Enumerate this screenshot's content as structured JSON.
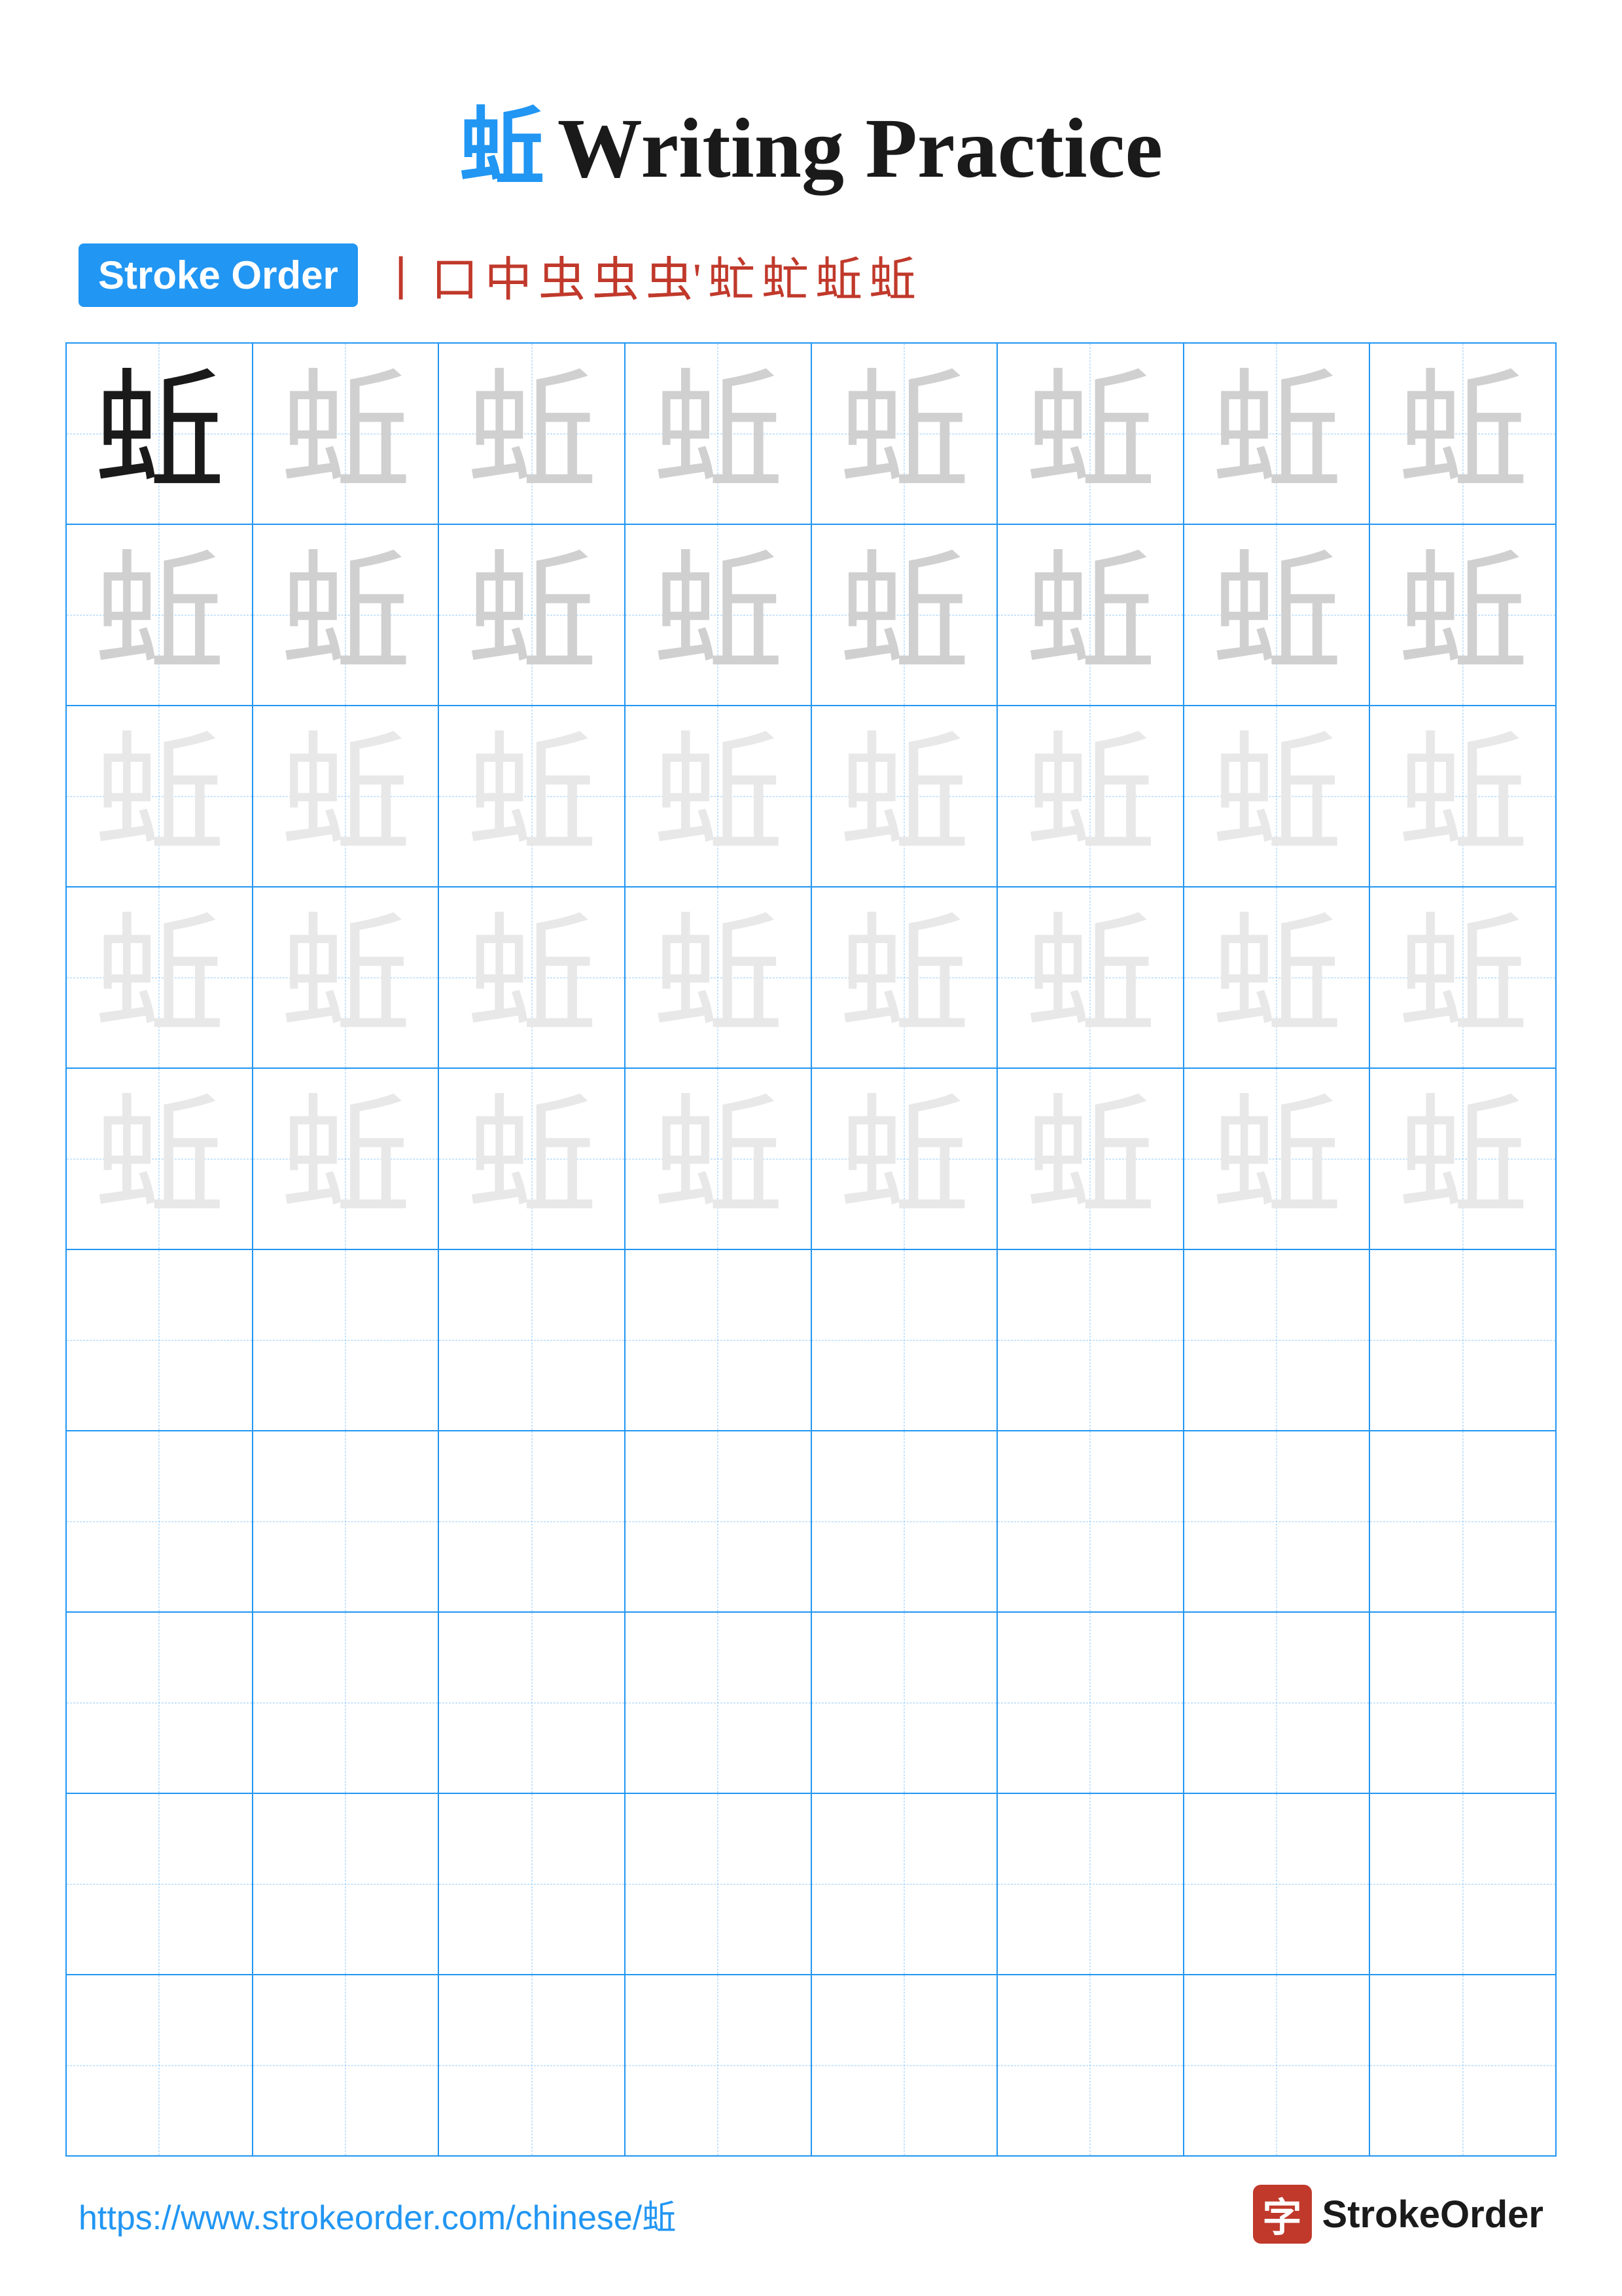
{
  "title": {
    "char": "蚯",
    "text": "Writing Practice"
  },
  "stroke_order": {
    "badge_label": "Stroke Order",
    "sequence": [
      "丨",
      "口",
      "中",
      "虫",
      "虫",
      "虫'",
      "虻",
      "虻",
      "蚯",
      "蚯"
    ]
  },
  "grid": {
    "rows": 10,
    "cols": 8,
    "char": "蚯",
    "filled_rows": 5,
    "practice_rows": 5
  },
  "footer": {
    "url": "https://www.strokeorder.com/chinese/蚯",
    "logo_text": "StrokeOrder",
    "logo_char": "字"
  }
}
